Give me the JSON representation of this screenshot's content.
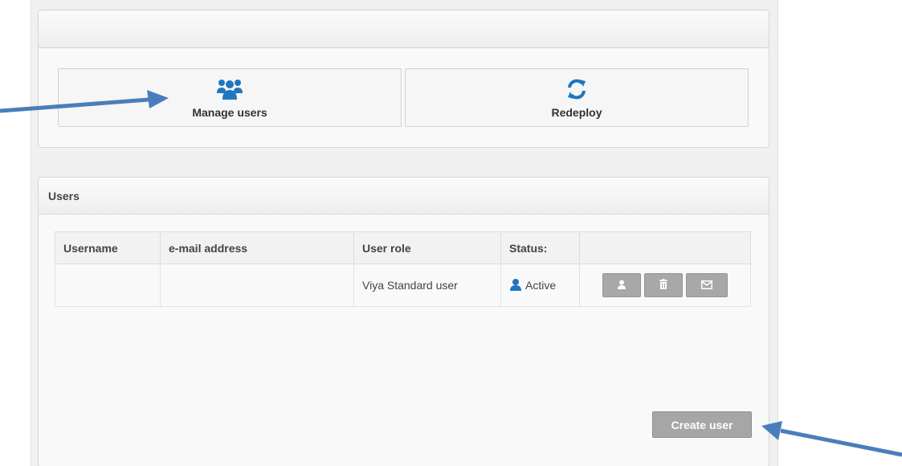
{
  "actions": {
    "manage_users_label": "Manage users",
    "redeploy_label": "Redeploy",
    "manage_users_icon": "users-icon",
    "redeploy_icon": "refresh-icon"
  },
  "users_panel": {
    "title": "Users",
    "columns": [
      "Username",
      "e-mail address",
      "User role",
      "Status:",
      ""
    ],
    "rows": [
      {
        "username": "",
        "email": "",
        "role": "Viya Standard user",
        "status": "Active"
      }
    ],
    "row_action_icons": [
      "user-icon",
      "trash-icon",
      "envelope-icon"
    ],
    "create_button_label": "Create user"
  },
  "colors": {
    "icon_blue": "#1f76bf",
    "arrow_blue": "#4a7ebb",
    "button_gray": "#a6a6a6"
  }
}
